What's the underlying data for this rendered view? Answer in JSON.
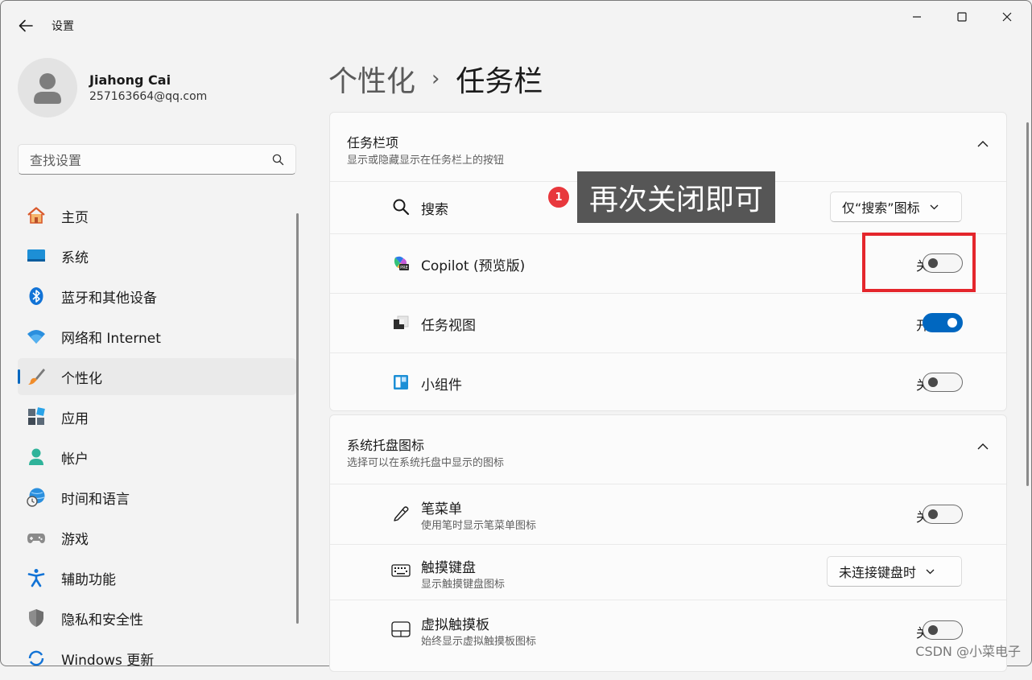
{
  "app": {
    "title": "设置"
  },
  "user": {
    "name": "Jiahong Cai",
    "email": "257163664@qq.com"
  },
  "search": {
    "placeholder": "查找设置"
  },
  "nav": {
    "items": [
      {
        "label": "主页",
        "icon": "home-icon"
      },
      {
        "label": "系统",
        "icon": "system-icon"
      },
      {
        "label": "蓝牙和其他设备",
        "icon": "bluetooth-icon"
      },
      {
        "label": "网络和 Internet",
        "icon": "wifi-icon"
      },
      {
        "label": "个性化",
        "icon": "brush-icon",
        "active": true
      },
      {
        "label": "应用",
        "icon": "apps-icon"
      },
      {
        "label": "帐户",
        "icon": "account-icon"
      },
      {
        "label": "时间和语言",
        "icon": "time-language-icon"
      },
      {
        "label": "游戏",
        "icon": "gamepad-icon"
      },
      {
        "label": "辅助功能",
        "icon": "accessibility-icon"
      },
      {
        "label": "隐私和安全性",
        "icon": "shield-icon"
      },
      {
        "label": "Windows 更新",
        "icon": "windows-update-icon"
      }
    ]
  },
  "breadcrumb": {
    "parent": "个性化",
    "separator": "›",
    "current": "任务栏"
  },
  "taskbar_items": {
    "title": "任务栏项",
    "subtitle": "显示或隐藏显示在任务栏上的按钮",
    "rows": [
      {
        "label": "搜索",
        "icon": "search-icon",
        "control": "dropdown",
        "value": "仅“搜索”图标"
      },
      {
        "label": "Copilot (预览版)",
        "icon": "copilot-icon",
        "control": "toggle",
        "state": "关",
        "on": false
      },
      {
        "label": "任务视图",
        "icon": "task-view-icon",
        "control": "toggle",
        "state": "开",
        "on": true
      },
      {
        "label": "小组件",
        "icon": "widgets-icon",
        "control": "toggle",
        "state": "关",
        "on": false
      }
    ]
  },
  "tray_icons": {
    "title": "系统托盘图标",
    "subtitle": "选择可以在系统托盘中显示的图标",
    "rows": [
      {
        "label": "笔菜单",
        "sub": "使用笔时显示笔菜单图标",
        "icon": "pen-icon",
        "control": "toggle",
        "state": "关",
        "on": false
      },
      {
        "label": "触摸键盘",
        "sub": "显示触摸键盘图标",
        "icon": "keyboard-icon",
        "control": "dropdown",
        "value": "未连接键盘时"
      },
      {
        "label": "虚拟触摸板",
        "sub": "始终显示虚拟触摸板图标",
        "icon": "touchpad-icon",
        "control": "toggle",
        "state": "关",
        "on": false
      }
    ]
  },
  "annotation": {
    "badge": "1",
    "text": "再次关闭即可"
  },
  "watermark": "CSDN @小菜电子",
  "colors": {
    "accent": "#0067c0",
    "annotation_red": "#e4262c",
    "annotation_box": "#565656"
  }
}
